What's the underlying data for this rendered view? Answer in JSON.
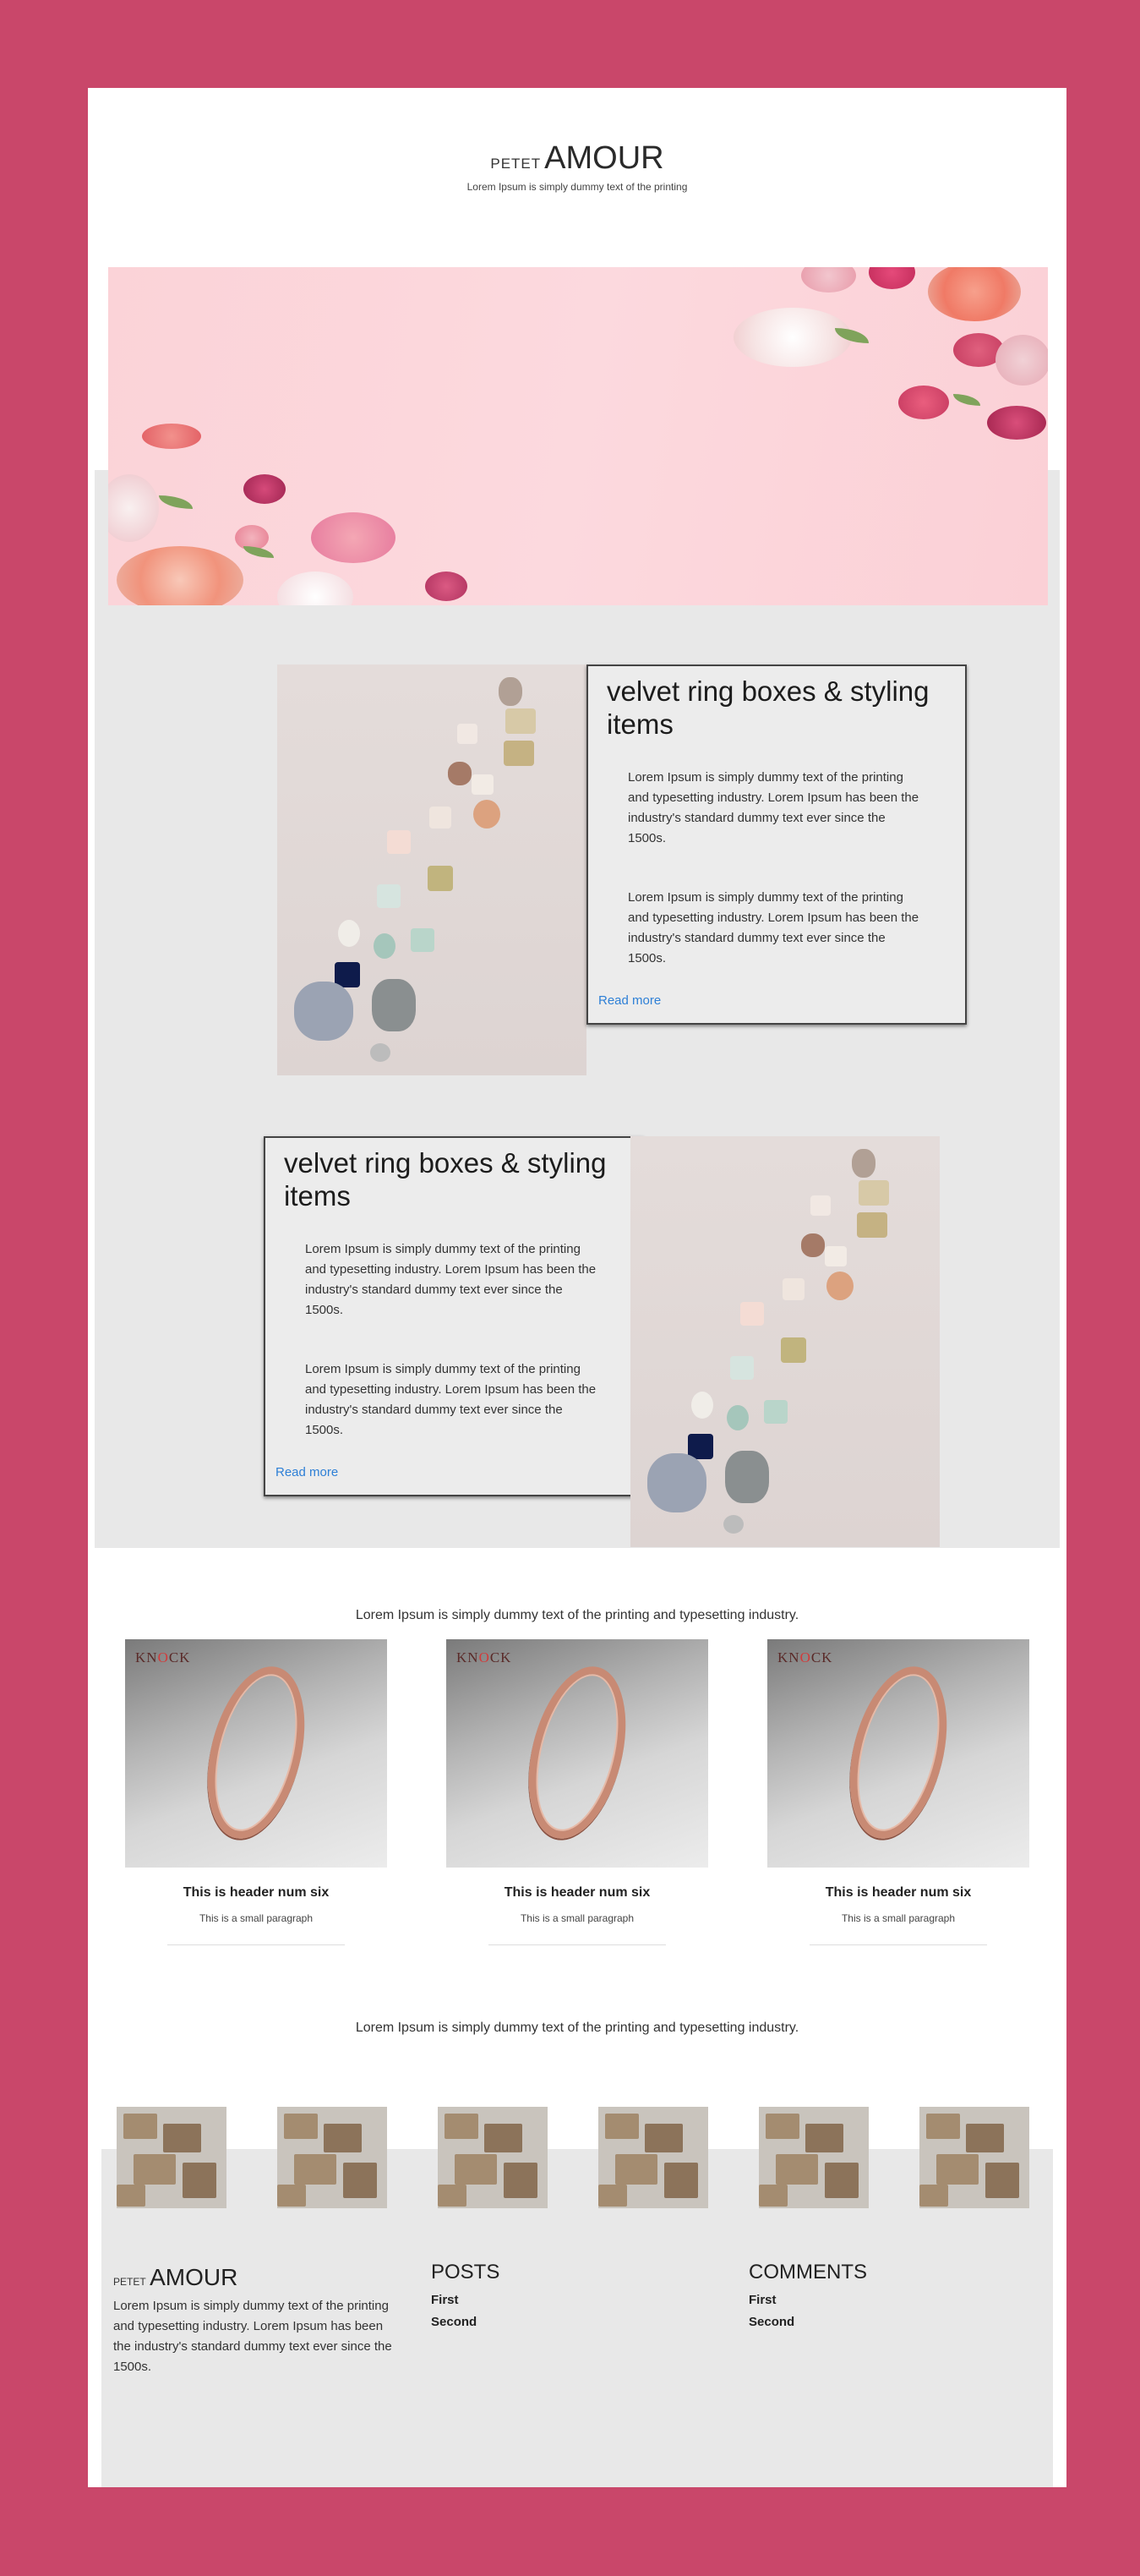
{
  "header": {
    "logo_small": "PETET",
    "logo_big": "AMOUR",
    "tagline": "Lorem Ipsum is simply dummy text of the printing"
  },
  "features": [
    {
      "title": "velvet ring boxes & styling items",
      "para1": "Lorem Ipsum is simply dummy text of the printing and typesetting industry. Lorem Ipsum has been the industry's standard dummy text ever since the 1500s.",
      "para2": "Lorem Ipsum is simply dummy text of the printing and typesetting industry. Lorem Ipsum has been the industry's standard dummy text ever since the 1500s.",
      "read_more": "Read more"
    },
    {
      "title": "velvet ring boxes & styling items",
      "para1": "Lorem Ipsum is simply dummy text of the printing and typesetting industry. Lorem Ipsum has been the industry's standard dummy text ever since the 1500s.",
      "para2": "Lorem Ipsum is simply dummy text of the printing and typesetting industry. Lorem Ipsum has been the industry's standard dummy text ever since the 1500s.",
      "read_more": "Read more"
    }
  ],
  "products_section": {
    "lead": "Lorem Ipsum is simply dummy text of the printing and typesetting industry.",
    "items": [
      {
        "brand_pre": "KN",
        "brand_o": "O",
        "brand_post": "CK",
        "title": "This is header num six",
        "subtitle": "This is a small paragraph"
      },
      {
        "brand_pre": "KN",
        "brand_o": "O",
        "brand_post": "CK",
        "title": "This is header num six",
        "subtitle": "This is a small paragraph"
      },
      {
        "brand_pre": "KN",
        "brand_o": "O",
        "brand_post": "CK",
        "title": "This is header num six",
        "subtitle": "This is a small paragraph"
      }
    ]
  },
  "gallery_section": {
    "lead": "Lorem Ipsum is simply dummy text of the printing and typesetting industry."
  },
  "footer": {
    "logo_small": "PETET",
    "logo_big": "AMOUR",
    "about": "Lorem Ipsum is simply dummy text of the printing and typesetting industry. Lorem Ipsum has been the industry's standard dummy text ever since the 1500s.",
    "posts_heading": "POSTS",
    "posts": [
      "First",
      "Second"
    ],
    "comments_heading": "COMMENTS",
    "comments": [
      "First",
      "Second"
    ]
  },
  "colors": {
    "frame": "#c9476a",
    "panel_grey": "#e8e8e8",
    "link": "#2d7fd6"
  }
}
